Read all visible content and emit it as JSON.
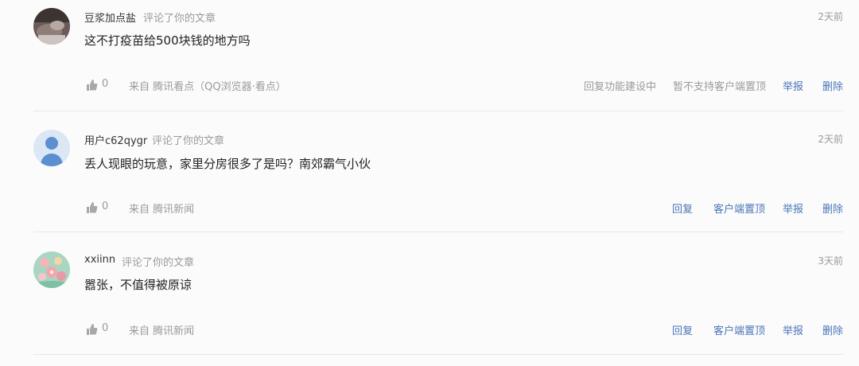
{
  "comments": [
    {
      "user": "豆浆加点盐",
      "action": "评论了你的文章",
      "time": "2天前",
      "text": "这不打疫苗给500块钱的地方吗",
      "likes": "0",
      "source": "来自 腾讯看点（QQ浏览器·看点）",
      "ops": [
        "回复功能建设中",
        "暂不支持客户端置顶",
        "举报",
        "删除"
      ]
    },
    {
      "user": "用户c62qygr",
      "action": "评论了你的文章",
      "time": "2天前",
      "text": "丢人现眼的玩意，家里分房很多了是吗？南郊霸气小伙",
      "likes": "0",
      "source": "来自 腾讯新闻",
      "ops": [
        "回复",
        "客户端置顶",
        "举报",
        "删除"
      ]
    },
    {
      "user": "xxiinn",
      "action": "评论了你的文章",
      "time": "3天前",
      "text": "嚣张，不值得被原谅",
      "likes": "0",
      "source": "来自 腾讯新闻",
      "ops": [
        "回复",
        "客户端置顶",
        "举报",
        "删除"
      ]
    }
  ],
  "colors": {
    "link": "#4a76b8",
    "muted": "#9a9a9a",
    "text": "#222222",
    "divider": "#e8e8e8"
  },
  "icons": {
    "like": "thumbs-up-icon"
  }
}
